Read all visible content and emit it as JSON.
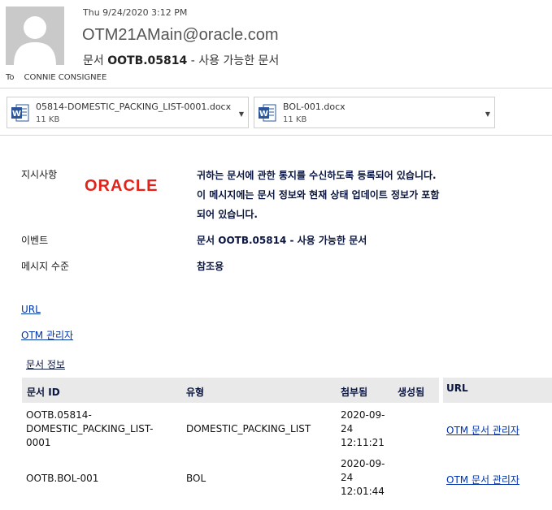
{
  "header": {
    "date": "Thu 9/24/2020 3:12 PM",
    "from": "OTM21AMain@oracle.com",
    "subject_prefix": "문서 ",
    "subject_id": "OOTB.05814",
    "subject_suffix": " - 사용 가능한 문서",
    "to_label": "To",
    "to_value": "CONNIE CONSIGNEE"
  },
  "attachments": [
    {
      "name": "05814-DOMESTIC_PACKING_LIST-0001.docx",
      "size": "11 KB",
      "icon": "word-doc-icon"
    },
    {
      "name": "BOL-001.docx",
      "size": "11 KB",
      "icon": "word-doc-icon"
    }
  ],
  "body": {
    "instructions_label": "지시사항",
    "logo_text": "ORACLE",
    "description": "귀하는 문서에 관한 통지를 수신하도록 등록되어 있습니다. 이 메시지에는 문서 정보와 현재 상태 업데이트 정보가 포함되어 있습니다.",
    "event_label": "이벤트",
    "event_value": "문서 OOTB.05814 - 사용 가능한 문서",
    "level_label": "메시지 수준",
    "level_value": "참조용",
    "url_link": "URL",
    "otm_admin_link": "OTM 관리자",
    "doc_info_title": "문서 정보"
  },
  "table": {
    "headers": [
      "문서 ID",
      "유형",
      "첨부됨",
      "생성됨",
      "URL"
    ],
    "rows": [
      {
        "id_lines": [
          "OOTB.05814-",
          "DOMESTIC_PACKING_LIST-",
          "0001"
        ],
        "type": "DOMESTIC_PACKING_LIST",
        "attached_lines": [
          "2020-09-",
          "24",
          "12:11:21"
        ],
        "created": "",
        "url": "OTM 문서 관리자"
      },
      {
        "id_lines": [
          "OOTB.BOL-001"
        ],
        "type": "BOL",
        "attached_lines": [
          "2020-09-",
          "24",
          "12:01:44"
        ],
        "created": "",
        "url": "OTM 문서 관리자"
      }
    ]
  },
  "colors": {
    "accent_red": "#e2231a",
    "navy_text": "#0a1640",
    "link_blue": "#0033aa",
    "header_bg": "#e9e9e9"
  }
}
